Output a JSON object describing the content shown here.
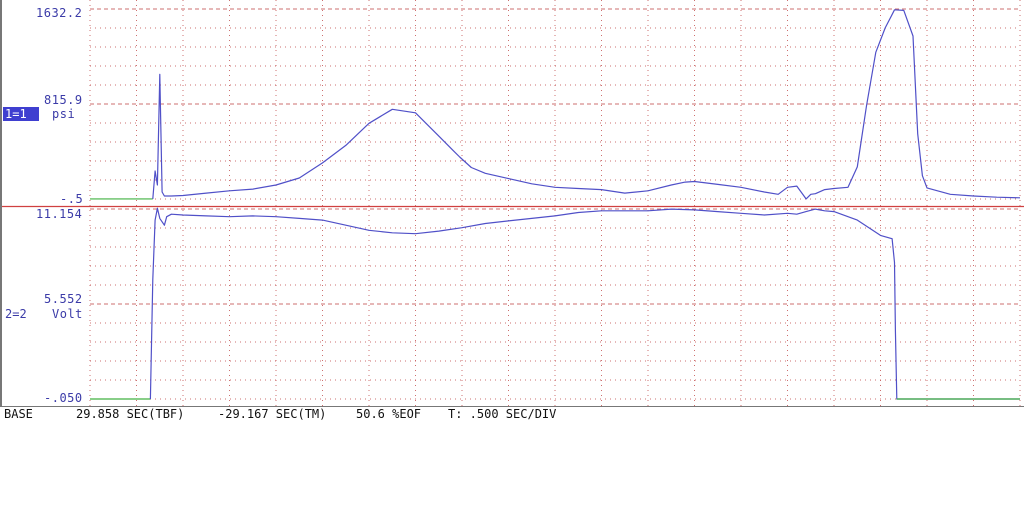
{
  "channels": [
    {
      "id": "1=1",
      "unit": "psi",
      "selected": true
    },
    {
      "id": "2=2",
      "unit": "Volt",
      "selected": false
    }
  ],
  "status_bar": {
    "base_label": "BASE",
    "tbf": "29.858 SEC(TBF)",
    "tm": "-29.167 SEC(TM)",
    "eof": "50.6 %EOF",
    "tdiv": "T: .500 SEC/DIV"
  },
  "colors": {
    "trace": "#5050c8",
    "grid": "#c86060",
    "baseline": "#d04040",
    "flat_segment": "#40b040",
    "label_text": "#3b3ba8",
    "selection": "#3f3fd0"
  },
  "chart_data": {
    "type": "line",
    "title": "",
    "grid": true,
    "x_divisions": 20,
    "time_per_div_sec": 0.5,
    "panels": [
      {
        "name": "1=1",
        "ylabel": "psi",
        "ytick_labels": [
          "1632.2",
          "815.9",
          "-.5"
        ],
        "ylim": [
          -0.5,
          1632.2
        ],
        "x": [
          0,
          1.35,
          1.4,
          1.45,
          1.5,
          1.55,
          1.6,
          1.75,
          2.0,
          2.5,
          3.0,
          3.5,
          4.0,
          4.5,
          5.0,
          5.5,
          6.0,
          6.5,
          7.0,
          7.5,
          7.8,
          7.95,
          8.2,
          8.5,
          9.0,
          9.5,
          10.0,
          10.5,
          11.0,
          11.5,
          12.0,
          12.5,
          12.8,
          13.0,
          13.5,
          14.0,
          14.5,
          14.8,
          15.0,
          15.2,
          15.4,
          15.5,
          15.6,
          15.8,
          16.0,
          16.3,
          16.5,
          16.7,
          16.9,
          17.1,
          17.3,
          17.5,
          17.7,
          17.8,
          17.9,
          18.0,
          18.5,
          19.0,
          19.5,
          20.0
        ],
        "y": [
          0,
          0,
          240,
          120,
          1070,
          60,
          25,
          25,
          30,
          50,
          70,
          85,
          120,
          180,
          310,
          460,
          650,
          770,
          740,
          540,
          420,
          360,
          270,
          220,
          175,
          130,
          100,
          90,
          80,
          50,
          70,
          120,
          145,
          150,
          125,
          100,
          60,
          40,
          100,
          110,
          0,
          40,
          45,
          80,
          90,
          100,
          275,
          800,
          1260,
          1470,
          1625,
          1620,
          1400,
          560,
          200,
          95,
          40,
          25,
          15,
          10
        ]
      },
      {
        "name": "2=2",
        "ylabel": "Volt",
        "ytick_labels": [
          "11.154",
          "5.552",
          "-.050"
        ],
        "ylim": [
          -0.05,
          11.154
        ],
        "x": [
          0,
          1.0,
          1.15,
          1.3,
          1.35,
          1.4,
          1.45,
          1.5,
          1.6,
          1.65,
          1.75,
          2.0,
          2.5,
          3.0,
          3.5,
          4.0,
          4.5,
          5.0,
          5.5,
          6.0,
          6.5,
          7.0,
          7.5,
          8.0,
          8.5,
          9.0,
          9.5,
          10.0,
          10.5,
          11.0,
          11.5,
          12.0,
          12.5,
          13.0,
          13.5,
          14.0,
          14.5,
          15.0,
          15.2,
          15.4,
          15.6,
          15.8,
          16.0,
          16.5,
          17.0,
          17.25,
          17.3,
          17.32,
          17.35,
          20.0
        ],
        "y": [
          -0.05,
          -0.05,
          -0.05,
          -0.05,
          7.0,
          10.5,
          11.2,
          10.6,
          10.2,
          10.7,
          10.85,
          10.8,
          10.75,
          10.7,
          10.75,
          10.7,
          10.6,
          10.5,
          10.2,
          9.9,
          9.75,
          9.7,
          9.85,
          10.05,
          10.3,
          10.45,
          10.6,
          10.75,
          10.95,
          11.05,
          11.05,
          11.05,
          11.15,
          11.1,
          11.0,
          10.9,
          10.8,
          10.9,
          10.85,
          11.0,
          11.15,
          11.05,
          11.0,
          10.5,
          9.6,
          9.4,
          8.0,
          4.0,
          -0.05,
          -0.05
        ]
      }
    ]
  }
}
